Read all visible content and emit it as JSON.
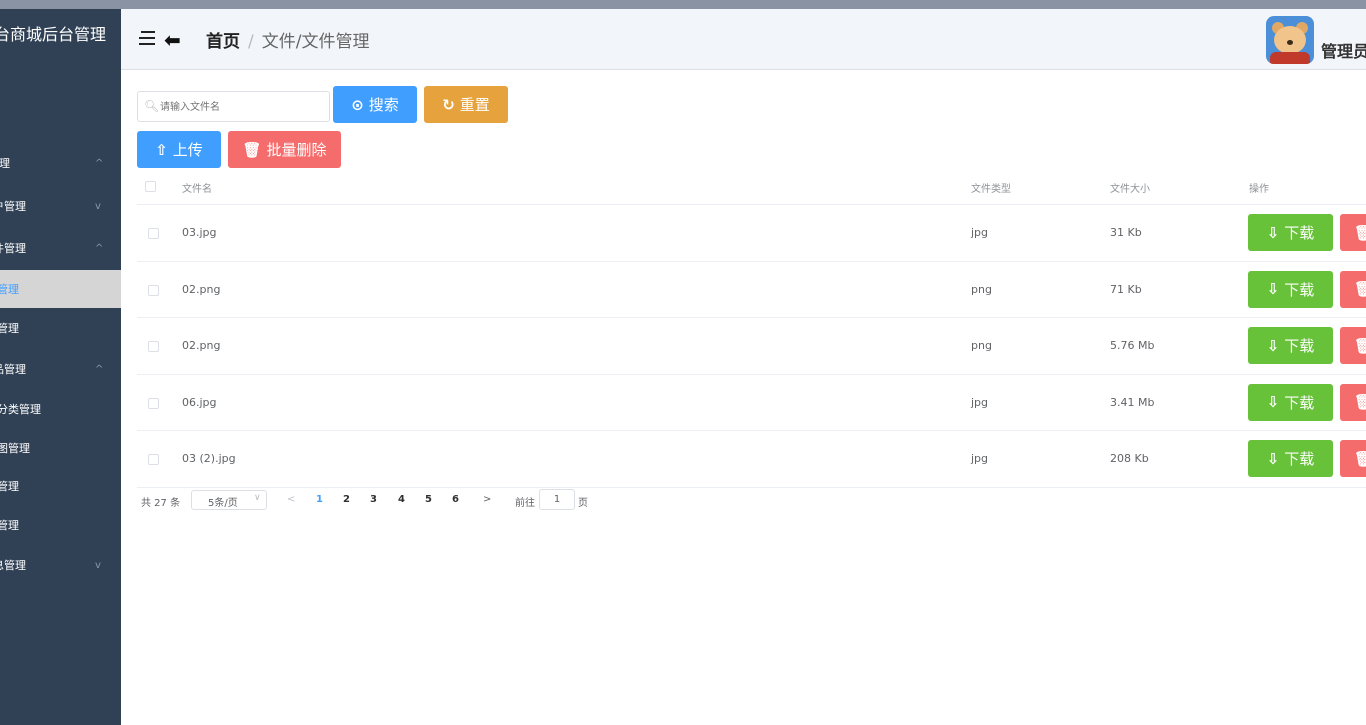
{
  "sidebar": {
    "brand": "后台商城后台管理",
    "items": [
      {
        "label": "系统管理",
        "arrow": "^"
      },
      {
        "label": "用户管理",
        "arrow": "v"
      },
      {
        "label": "文件管理",
        "arrow": "^"
      },
      {
        "label": "文件管理"
      },
      {
        "label": "日志管理"
      },
      {
        "label": "商品管理",
        "arrow": "^"
      },
      {
        "label": "商品分类管理"
      },
      {
        "label": "轮播图管理"
      },
      {
        "label": "订单管理"
      },
      {
        "label": "地址管理"
      },
      {
        "label": "信息管理",
        "arrow": "v"
      }
    ]
  },
  "header": {
    "home": "首页",
    "sep": "/",
    "current": "文件/文件管理",
    "username": "管理员"
  },
  "toolbar": {
    "search_placeholder": "请输入文件名",
    "search_label": "搜索",
    "reset_label": "重置",
    "upload_label": "上传",
    "batch_delete_label": "批量删除"
  },
  "table": {
    "columns": [
      "文件名",
      "文件类型",
      "文件大小",
      "操作"
    ],
    "rows": [
      {
        "name": "03.jpg",
        "type": "jpg",
        "size": "31 Kb"
      },
      {
        "name": "02.png",
        "type": "png",
        "size": "71 Kb"
      },
      {
        "name": "02.png",
        "type": "png",
        "size": "5.76 Mb"
      },
      {
        "name": "06.jpg",
        "type": "jpg",
        "size": "3.41 Mb"
      },
      {
        "name": "03 (2).jpg",
        "type": "jpg",
        "size": "208 Kb"
      }
    ],
    "download_label": "下载",
    "delete_label": "删除"
  },
  "pagination": {
    "total": "共 27 条",
    "page_size": "5条/页",
    "pages": [
      "1",
      "2",
      "3",
      "4",
      "5",
      "6"
    ],
    "current_page": "1",
    "goto_prefix": "前往",
    "goto_value": "1",
    "goto_suffix": "页"
  },
  "colors": {
    "sidebar_bg": "#304156",
    "primary": "#409eff",
    "warning": "#e6a23c",
    "danger": "#f56c6c",
    "success": "#67c23a"
  }
}
